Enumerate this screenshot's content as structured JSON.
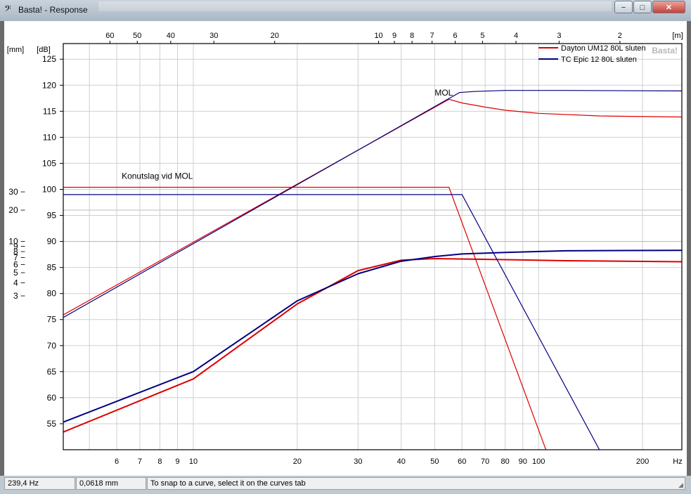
{
  "window": {
    "title": "Basta! - Response",
    "app_icon": "bass-clef-icon",
    "buttons": {
      "minimize": "−",
      "maximize": "□",
      "close": "✕"
    }
  },
  "chart_data": {
    "type": "line",
    "watermark": "Basta!",
    "y_left_label": "[mm]",
    "y_right_label": "[dB]",
    "x_bottom_unit": "Hz",
    "x_top_unit": "[m]",
    "x_scale": "log",
    "xlim": [
      4.2,
      260
    ],
    "ylim": [
      50,
      128
    ],
    "y_ticks": [
      55,
      60,
      65,
      70,
      75,
      80,
      85,
      90,
      95,
      100,
      105,
      110,
      115,
      120,
      125
    ],
    "mm_ticks": [
      3,
      4,
      5,
      6,
      7,
      8,
      9,
      10,
      20,
      30
    ],
    "mm_axis": "log",
    "x_ticks": [
      5,
      6,
      7,
      8,
      9,
      10,
      20,
      30,
      40,
      50,
      60,
      70,
      80,
      90,
      100,
      200
    ],
    "x_tick_labels": [
      "",
      "6",
      "7",
      "8",
      "9",
      "10",
      "20",
      "30",
      "40",
      "50",
      "60",
      "70",
      "80",
      "90",
      "100",
      "200"
    ],
    "wavelength_ticks": [
      60,
      50,
      40,
      30,
      20,
      10,
      9,
      8,
      7,
      6,
      5,
      4,
      3,
      2
    ],
    "annotations": [
      {
        "text": "MOL",
        "x": 50,
        "y": 118
      },
      {
        "text": "Konutslag vid MOL",
        "x": 6.2,
        "y": 102
      }
    ],
    "legend_position": "top-right",
    "series": [
      {
        "name": "Dayton UM12 80L sluten",
        "color": "#dd0000",
        "curves": {
          "mol": [
            [
              4.2,
              75.9
            ],
            [
              55,
              117.3
            ],
            [
              60,
              116.6
            ],
            [
              70,
              115.8
            ],
            [
              80,
              115.2
            ],
            [
              100,
              114.6
            ],
            [
              150,
              114.1
            ],
            [
              260,
              113.9
            ]
          ],
          "excursion": [
            [
              4.2,
              100.4
            ],
            [
              55,
              100.4
            ],
            [
              105,
              50
            ]
          ],
          "response": [
            [
              4.2,
              53.4
            ],
            [
              10,
              63.6
            ],
            [
              20,
              78
            ],
            [
              30,
              84.4
            ],
            [
              40,
              86.4
            ],
            [
              50,
              86.7
            ],
            [
              80,
              86.5
            ],
            [
              120,
              86.3
            ],
            [
              260,
              86.1
            ]
          ]
        }
      },
      {
        "name": "TC Epic 12 80L sluten",
        "color": "#00007f",
        "curves": {
          "mol": [
            [
              4.2,
              75.4
            ],
            [
              59,
              118.6
            ],
            [
              65,
              118.8
            ],
            [
              80,
              119
            ],
            [
              120,
              119
            ],
            [
              260,
              118.9
            ]
          ],
          "excursion": [
            [
              4.2,
              99
            ],
            [
              60,
              99
            ],
            [
              150,
              50
            ]
          ],
          "response": [
            [
              4.2,
              55.3
            ],
            [
              10,
              65
            ],
            [
              20,
              78.6
            ],
            [
              30,
              83.8
            ],
            [
              40,
              86.2
            ],
            [
              50,
              87.1
            ],
            [
              60,
              87.6
            ],
            [
              80,
              87.9
            ],
            [
              120,
              88.2
            ],
            [
              260,
              88.3
            ]
          ]
        }
      }
    ]
  },
  "status": {
    "freq": "239,4 Hz",
    "excursion": "0,0618 mm",
    "hint": "To snap to a curve, select it on the curves tab"
  }
}
